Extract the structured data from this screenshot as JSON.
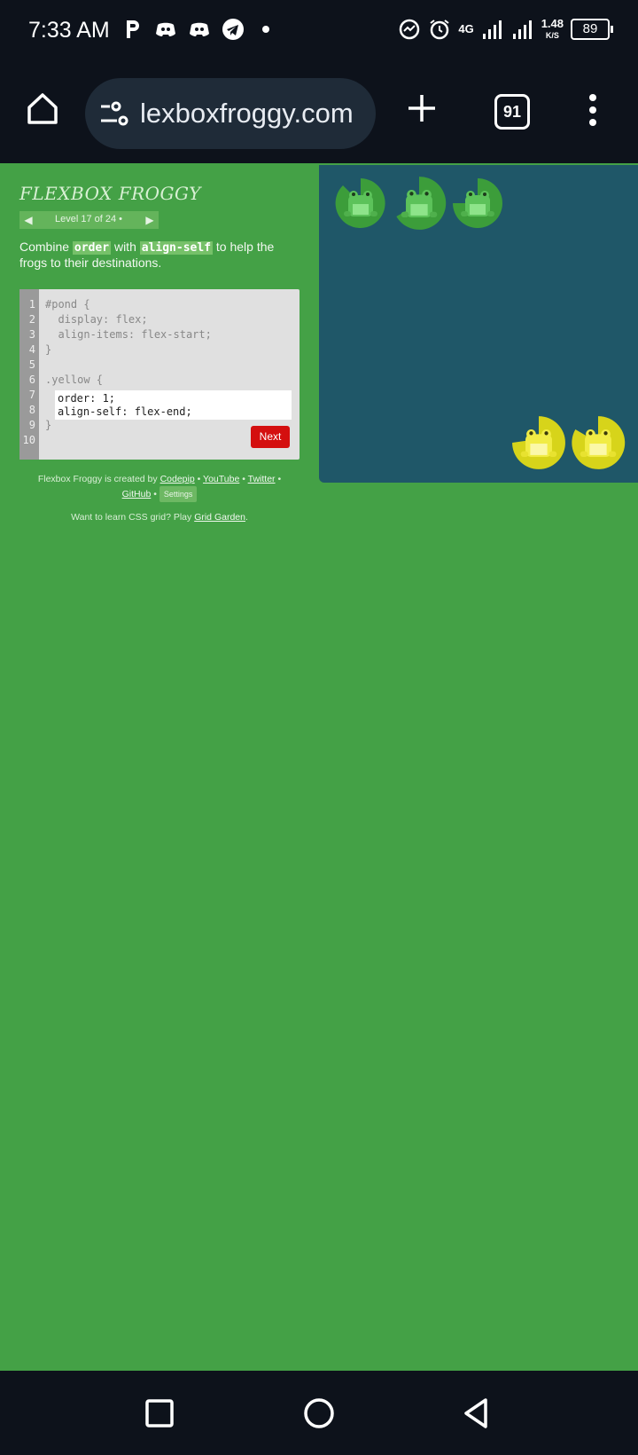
{
  "status_bar": {
    "time": "7:33 AM",
    "network": "4G",
    "speed_value": "1.48",
    "speed_unit": "K/S",
    "battery": "89"
  },
  "browser": {
    "url": "lexboxfroggy.com",
    "tab_count": "91"
  },
  "game": {
    "logo": "FLEXBOX FROGGY",
    "level_text": "Level 17 of 24 •",
    "instruction_pre": "Combine ",
    "instruction_code1": "order",
    "instruction_mid": " with ",
    "instruction_code2": "align-self",
    "instruction_post": " to help the frogs to their destinations.",
    "line_numbers": [
      "1",
      "2",
      "3",
      "4",
      "5",
      "6",
      "7",
      "8",
      "9",
      "10"
    ],
    "code_lines": [
      "#pond {",
      "  display: flex;",
      "  align-items: flex-start;",
      "}",
      "",
      ".yellow {"
    ],
    "input_lines": [
      "order: 1;",
      "align-self: flex-end;"
    ],
    "closing_brace": "}",
    "next_label": "Next",
    "credits_prefix": "Flexbox Froggy is created by ",
    "credit_codepip": "Codepip",
    "credit_youtube": "YouTube",
    "credit_twitter": "Twitter",
    "credit_github": "GitHub",
    "settings_label": "Settings",
    "separator": " • ",
    "garden_prefix": "Want to learn CSS grid? Play ",
    "garden_link": "Grid Garden",
    "garden_suffix": "."
  },
  "pond": {
    "green_frogs": 3,
    "yellow_frogs": 2,
    "green_color": "#3c9d3a",
    "yellow_color": "#d7d41a",
    "water_color": "#1f5768"
  },
  "icons": {
    "home": "home-icon",
    "site_settings": "tune-icon",
    "new_tab": "plus-icon",
    "menu": "more-vert-icon",
    "recents": "square-icon",
    "home_nav": "circle-icon",
    "back": "triangle-back-icon"
  }
}
